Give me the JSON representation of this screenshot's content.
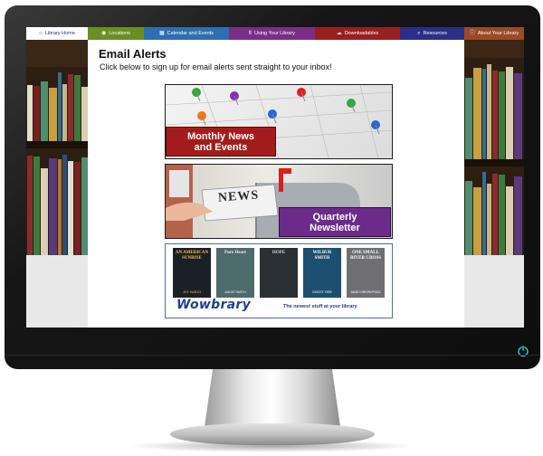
{
  "nav": {
    "items": [
      {
        "label": "Library Home",
        "icon": "home-icon",
        "glyph": "⌂",
        "color": "#ffffff",
        "text_color": "#1a3a8f"
      },
      {
        "label": "Locations",
        "icon": "map-pin-icon",
        "glyph": "◉",
        "color": "#6b8e23",
        "text_color": "#ffffff"
      },
      {
        "label": "Calendar and Events",
        "icon": "calendar-icon",
        "glyph": "▦",
        "color": "#2f6eb0",
        "text_color": "#ffffff"
      },
      {
        "label": "Using Your Library",
        "icon": "books-icon",
        "glyph": "Ⅱ",
        "color": "#7a2e88",
        "text_color": "#ffffff"
      },
      {
        "label": "Downloadables",
        "icon": "download-icon",
        "glyph": "☁",
        "color": "#9a1f1f",
        "text_color": "#ffffff"
      },
      {
        "label": "Resources",
        "icon": "search-icon",
        "glyph": "⌕",
        "color": "#2b2f86",
        "text_color": "#ffffff"
      },
      {
        "label": "About Your Library",
        "icon": "info-icon",
        "glyph": "ⓘ",
        "color": "#9a4a24",
        "text_color": "#ffffff"
      }
    ]
  },
  "page": {
    "title": "Email Alerts",
    "subtitle": "Click below to sign up for email alerts sent straight to your inbox!"
  },
  "banners": {
    "monthly": {
      "line1": "Monthly News",
      "line2": "and Events"
    },
    "quarterly": {
      "line1": "Quarterly",
      "line2": "Newsletter",
      "sign": "NEWS"
    },
    "wowbrary": {
      "logo": "Wowbrary",
      "tagline": "The newest stuff at your library",
      "books": [
        {
          "title": "AN AMERICAN SUNRISE",
          "author": "JOY HARJO",
          "bg": "#1b1f26",
          "fg": "#f2c14e"
        },
        {
          "title": "Pure Heart",
          "author": "ANGIE SMITH",
          "bg": "#4d6b6a",
          "fg": "#f3efe6"
        },
        {
          "title": "HOPE",
          "author": "",
          "bg": "#2a2f33",
          "fg": "#d8d8d8"
        },
        {
          "title": "WILBUR SMITH",
          "author": "GHOST FIRE",
          "bg": "#1d4f70",
          "fg": "#ffffff"
        },
        {
          "title": "ONE SMALL RIVER CROSS",
          "author": "JANE KIRKPATRICK",
          "bg": "#6f6f73",
          "fg": "#ffffff"
        }
      ]
    }
  },
  "power": {
    "icon": "power-icon"
  }
}
